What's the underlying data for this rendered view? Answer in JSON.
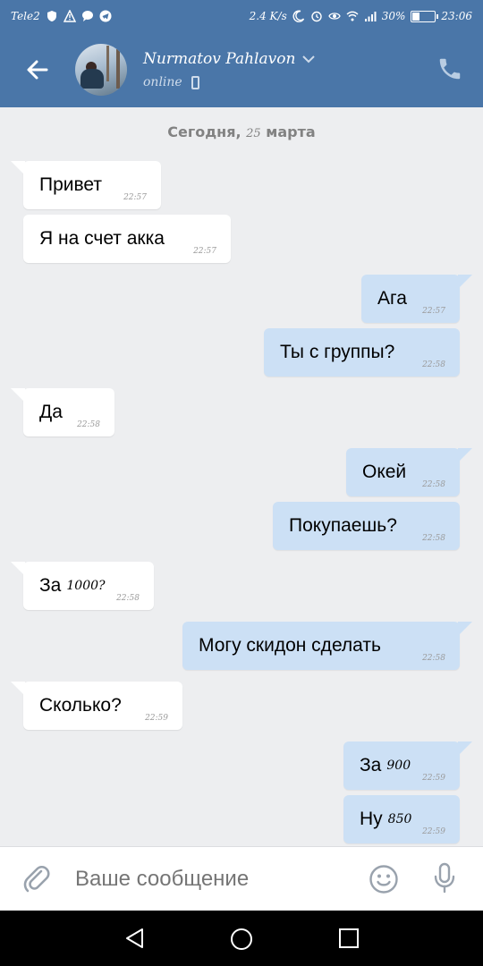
{
  "status_bar": {
    "carrier": "Tele2",
    "speed": "2.4 K/s",
    "battery": "30%",
    "time": "23:06"
  },
  "header": {
    "contact_name": "Nurmatov Pahlavon",
    "status": "online"
  },
  "chat": {
    "date_prefix": "Сегодня,",
    "date_day": "25",
    "date_month": "марта",
    "messages": [
      {
        "dir": "in",
        "text": "Привет",
        "time": "22:57"
      },
      {
        "dir": "in",
        "text": "Я на счет акка",
        "time": "22:57"
      },
      {
        "dir": "out",
        "text": "Ага",
        "time": "22:57"
      },
      {
        "dir": "out",
        "text": "Ты с группы?",
        "time": "22:58"
      },
      {
        "dir": "in",
        "text": "Да",
        "time": "22:58"
      },
      {
        "dir": "out",
        "text": "Окей",
        "time": "22:58"
      },
      {
        "dir": "out",
        "text": "Покупаешь?",
        "time": "22:58"
      },
      {
        "dir": "in",
        "text": "За",
        "extra": "1000?",
        "time": "22:58"
      },
      {
        "dir": "out",
        "text": "Могу скидон сделать",
        "time": "22:58"
      },
      {
        "dir": "in",
        "text": "Сколько?",
        "time": "22:59"
      },
      {
        "dir": "out",
        "text": "За",
        "extra": "900",
        "time": "22:59"
      },
      {
        "dir": "out",
        "text": "Ну",
        "extra": "850",
        "time": "22:59"
      }
    ]
  },
  "composer": {
    "placeholder": "Ваше сообщение"
  },
  "colors": {
    "brand": "#4a76a8",
    "incoming_bubble": "#ffffff",
    "outgoing_bubble": "#cce0f5",
    "chat_background": "#edeef0"
  },
  "icons": [
    "back-arrow-icon",
    "phone-icon",
    "paperclip-icon",
    "emoji-icon",
    "microphone-icon",
    "nav-back-icon",
    "nav-home-icon",
    "nav-recent-icon"
  ]
}
